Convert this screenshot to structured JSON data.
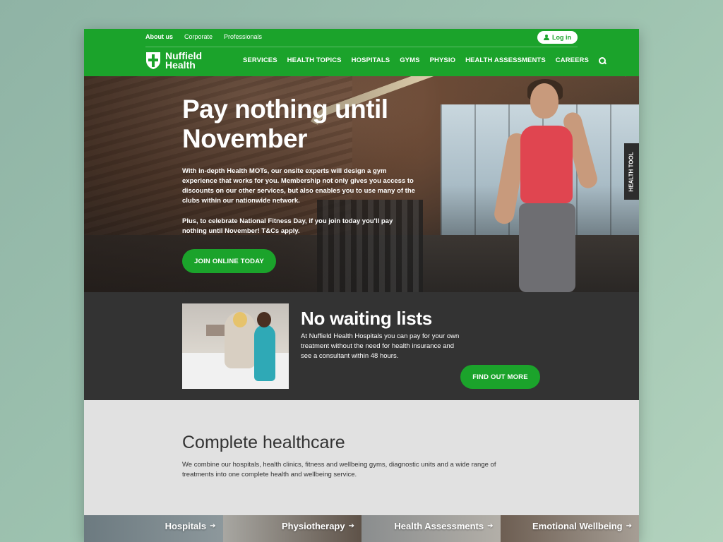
{
  "header": {
    "util_links": [
      "About us",
      "Corporate",
      "Professionals"
    ],
    "login_label": "Log in",
    "logo_line1": "Nuffield",
    "logo_line2": "Health",
    "nav": [
      "SERVICES",
      "HEALTH TOPICS",
      "HOSPITALS",
      "GYMS",
      "PHYSIO",
      "HEALTH ASSESSMENTS",
      "CAREERS"
    ]
  },
  "hero": {
    "title": "Pay nothing until November",
    "body": "With in-depth Health MOTs, our onsite experts will design a gym experience that works for you. Membership not only gives you access to discounts on our other services, but also enables you to use many of the clubs within our nationwide network.",
    "body2": "Plus, to celebrate National Fitness Day, if you join today you'll pay nothing until November! T&Cs apply.",
    "cta": "JOIN ONLINE TODAY",
    "side_tab": "HEALTH TOOL"
  },
  "promo": {
    "title": "No waiting lists",
    "body": "At Nuffield Health Hospitals you can pay for your own treatment without the need for health insurance and see a consultant within 48 hours.",
    "cta": "FIND OUT MORE"
  },
  "healthcare": {
    "title": "Complete healthcare",
    "body": "We combine our hospitals, health clinics, fitness and wellbeing gyms, diagnostic units and a wide range of treatments into one complete health and wellbeing service."
  },
  "tiles": [
    "Hospitals",
    "Physiotherapy",
    "Health Assessments",
    "Emotional Wellbeing"
  ],
  "colors": {
    "brand_green": "#1ba32b",
    "dark_band": "#333333",
    "light_band": "#e1e1e1"
  }
}
